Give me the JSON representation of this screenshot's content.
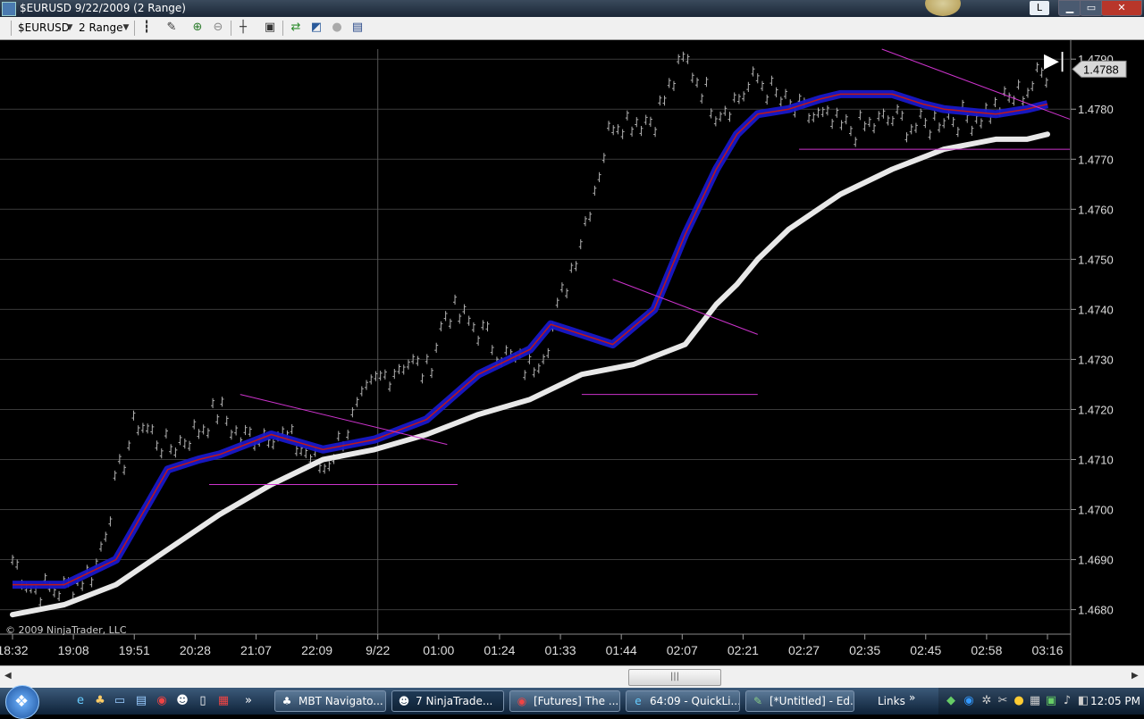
{
  "window": {
    "title": "$EURUSD  9/22/2009 (2 Range)",
    "l_button": "L",
    "min_glyph": "▁",
    "max_glyph": "▭",
    "close_glyph": "✕"
  },
  "toolbar": {
    "instrument": "$EURUSD",
    "period": "2 Range",
    "icons": [
      "bar-style-icon",
      "drawing-tool-icon",
      "zoom-in-icon",
      "zoom-out-icon",
      "crosshair-icon",
      "properties-icon",
      "data-series-icon",
      "indicators-icon",
      "strategies-icon",
      "chart-trader-icon"
    ]
  },
  "chart": {
    "copyright": "© 2009 NinjaTrader, LLC",
    "current_price_label": "1.4788",
    "scroll_end_glyph": "▶|",
    "colors": {
      "background": "#000000",
      "grid": "#3a3a3a",
      "ribbon_blue": "#1818c8",
      "ribbon_red": "#c01818",
      "trendline": "#cc33cc",
      "long_ma": "#e8e8e8",
      "bars": "#b0b0b0"
    }
  },
  "chart_data": {
    "type": "line",
    "x_tick_labels": [
      "18:32",
      "19:08",
      "19:51",
      "20:28",
      "21:07",
      "22:09",
      "9/22",
      "01:00",
      "01:24",
      "01:33",
      "01:44",
      "02:07",
      "02:21",
      "02:27",
      "02:35",
      "02:45",
      "02:58",
      "03:16"
    ],
    "y_tick_labels": [
      "1.4680",
      "1.4690",
      "1.4700",
      "1.4710",
      "1.4720",
      "1.4730",
      "1.4740",
      "1.4750",
      "1.4760",
      "1.4770",
      "1.4780",
      "1.4790"
    ],
    "ylim": [
      1.4676,
      1.4792
    ],
    "grid": true,
    "last_price": 1.4788,
    "series": [
      {
        "key": "price",
        "x": [
          0,
          2,
          5,
          8,
          10,
          12,
          15,
          18,
          20,
          22,
          25,
          28,
          30,
          32,
          35,
          38,
          40,
          42,
          45,
          48,
          50,
          52,
          55,
          58,
          60,
          62,
          65,
          68,
          70,
          72,
          75,
          78,
          80,
          82,
          85,
          88,
          90,
          92,
          95,
          98,
          100
        ],
        "values": [
          1.469,
          1.4684,
          1.4684,
          1.4688,
          1.4705,
          1.4718,
          1.4712,
          1.4716,
          1.472,
          1.4714,
          1.4716,
          1.4712,
          1.4708,
          1.4715,
          1.4725,
          1.473,
          1.4727,
          1.474,
          1.4736,
          1.473,
          1.4728,
          1.4735,
          1.4755,
          1.4778,
          1.4778,
          1.4778,
          1.479,
          1.478,
          1.4782,
          1.4786,
          1.478,
          1.4778,
          1.4776,
          1.4776,
          1.4778,
          1.4776,
          1.4779,
          1.4778,
          1.478,
          1.4784,
          1.4788
        ]
      },
      {
        "key": "fast_ma",
        "x": [
          0,
          5,
          10,
          15,
          18,
          20,
          25,
          30,
          35,
          40,
          45,
          50,
          52,
          55,
          58,
          62,
          65,
          68,
          70,
          72,
          75,
          78,
          80,
          85,
          88,
          90,
          95,
          98,
          100
        ],
        "values": [
          1.4685,
          1.4685,
          1.469,
          1.4708,
          1.471,
          1.4711,
          1.4715,
          1.4712,
          1.4714,
          1.4718,
          1.4727,
          1.4732,
          1.4737,
          1.4735,
          1.4733,
          1.474,
          1.4755,
          1.4768,
          1.4775,
          1.4779,
          1.478,
          1.4782,
          1.4783,
          1.4783,
          1.4781,
          1.478,
          1.4779,
          1.478,
          1.4781
        ]
      },
      {
        "key": "slow_ma",
        "x": [
          0,
          5,
          10,
          15,
          20,
          25,
          30,
          35,
          40,
          45,
          50,
          55,
          60,
          65,
          68,
          70,
          72,
          75,
          80,
          85,
          90,
          95,
          98,
          100
        ],
        "values": [
          1.4679,
          1.4681,
          1.4685,
          1.4692,
          1.4699,
          1.4705,
          1.471,
          1.4712,
          1.4715,
          1.4719,
          1.4722,
          1.4727,
          1.4729,
          1.4733,
          1.4741,
          1.4745,
          1.475,
          1.4756,
          1.4763,
          1.4768,
          1.4772,
          1.4774,
          1.4774,
          1.4775
        ]
      }
    ]
  },
  "scrollbar": {
    "left_arrow": "◀",
    "right_arrow": "▶",
    "thumb_grip": "|||"
  },
  "taskbar": {
    "tasks": [
      {
        "label": "MBT Navigato...",
        "icon": "hat-icon"
      },
      {
        "label": "7 NinjaTrade...",
        "icon": "ninja-icon"
      },
      {
        "label": "[Futures] The ...",
        "icon": "chrome-icon"
      },
      {
        "label": "64:09 - QuickLi...",
        "icon": "ie-icon"
      },
      {
        "label": "[*Untitled] - Ed...",
        "icon": "editor-icon"
      }
    ],
    "links_label": "Links",
    "overflow_glyph": "»",
    "clock": "12:05 PM"
  }
}
